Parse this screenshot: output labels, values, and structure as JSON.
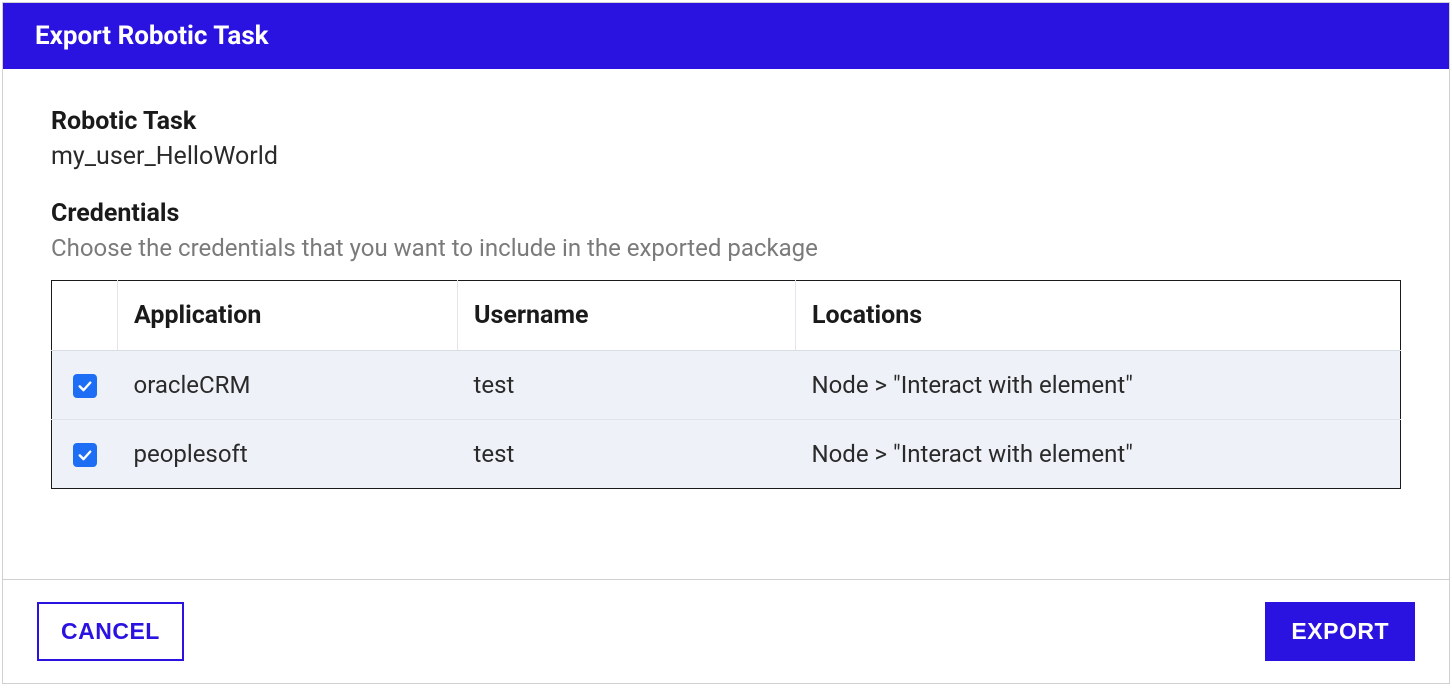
{
  "dialog": {
    "title": "Export Robotic Task"
  },
  "robotic_task": {
    "label": "Robotic Task",
    "value": "my_user_HelloWorld"
  },
  "credentials": {
    "label": "Credentials",
    "description": "Choose the credentials that you want to include in the exported package",
    "columns": {
      "application": "Application",
      "username": "Username",
      "locations": "Locations"
    },
    "rows": [
      {
        "checked": true,
        "application": "oracleCRM",
        "username": "test",
        "locations": "Node > \"Interact with element\""
      },
      {
        "checked": true,
        "application": "peoplesoft",
        "username": "test",
        "locations": "Node > \"Interact with element\""
      }
    ]
  },
  "footer": {
    "cancel": "CANCEL",
    "export": "EXPORT"
  }
}
